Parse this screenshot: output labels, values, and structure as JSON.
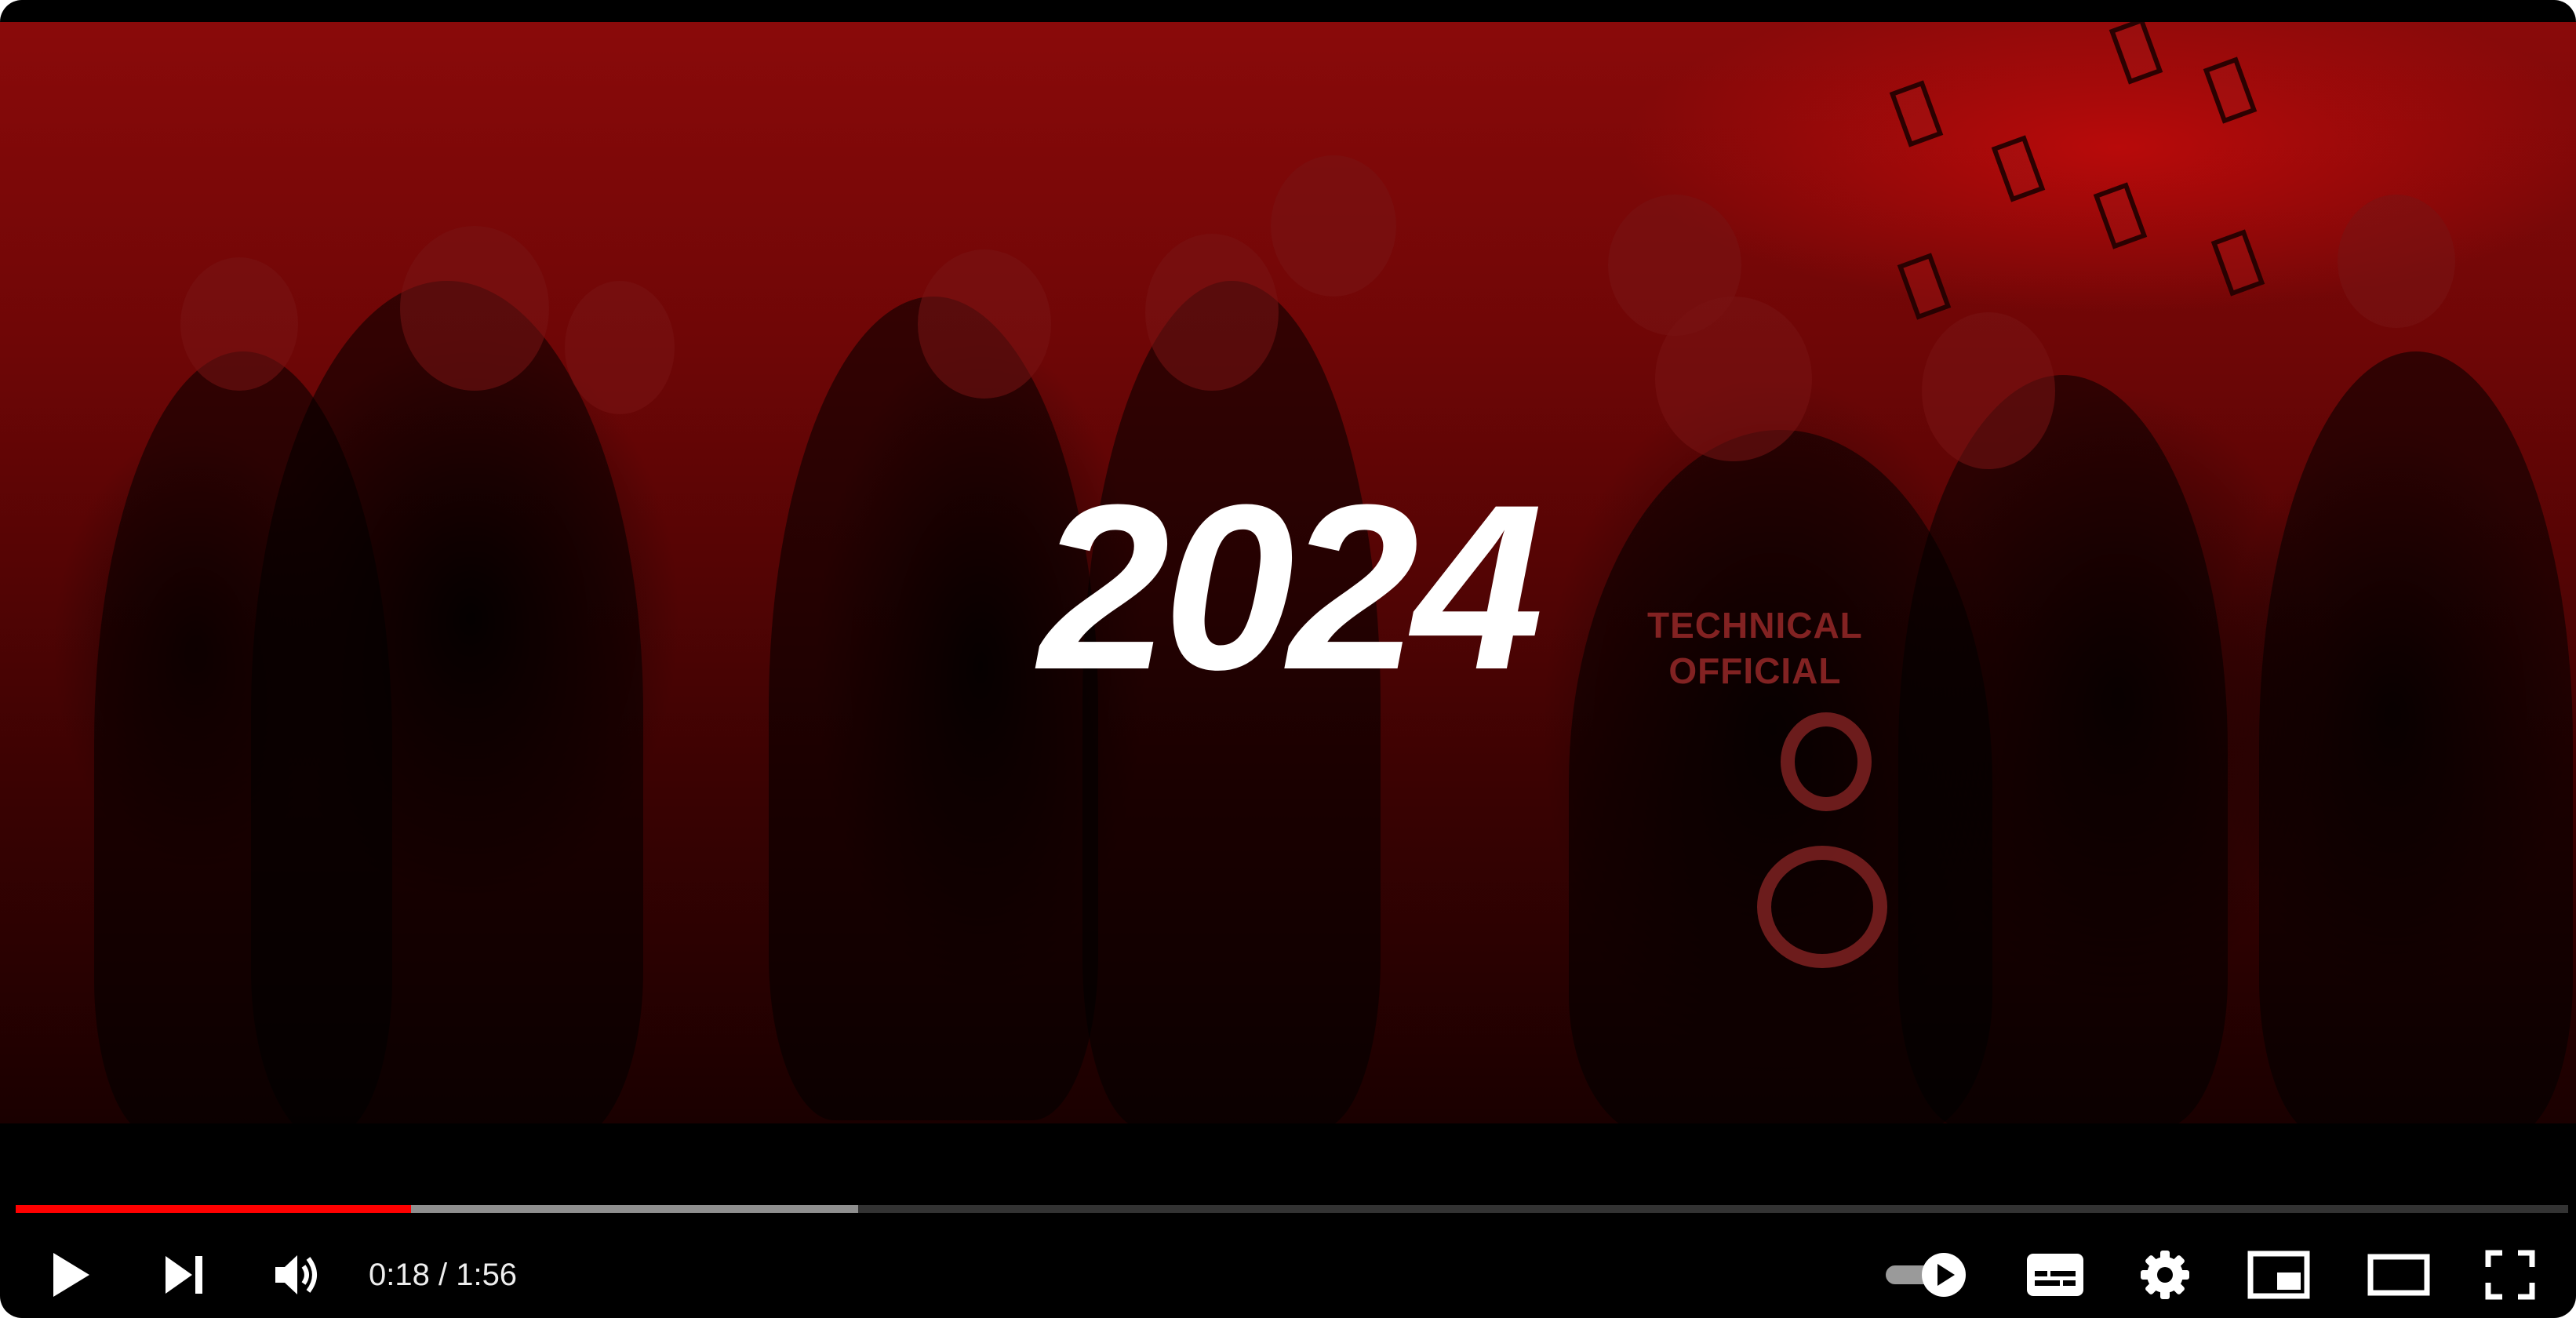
{
  "video": {
    "overlay_title": "2024",
    "vest_text_line1": "TECHNICAL",
    "vest_text_line2": "OFFICIAL"
  },
  "player": {
    "current_time": "0:18",
    "separator": " / ",
    "duration": "1:56",
    "played_fraction": 0.155,
    "buffered_fraction": 0.33
  },
  "controls": {
    "icons": [
      "play-icon",
      "next-icon",
      "volume-icon",
      "autoplay-toggle-icon",
      "subtitles-icon",
      "settings-icon",
      "miniplayer-icon",
      "theater-mode-icon",
      "fullscreen-icon"
    ]
  },
  "colors": {
    "accent": "#ff0000",
    "tint": "#8a0a0a",
    "background": "#000000",
    "icon": "#ffffff"
  }
}
